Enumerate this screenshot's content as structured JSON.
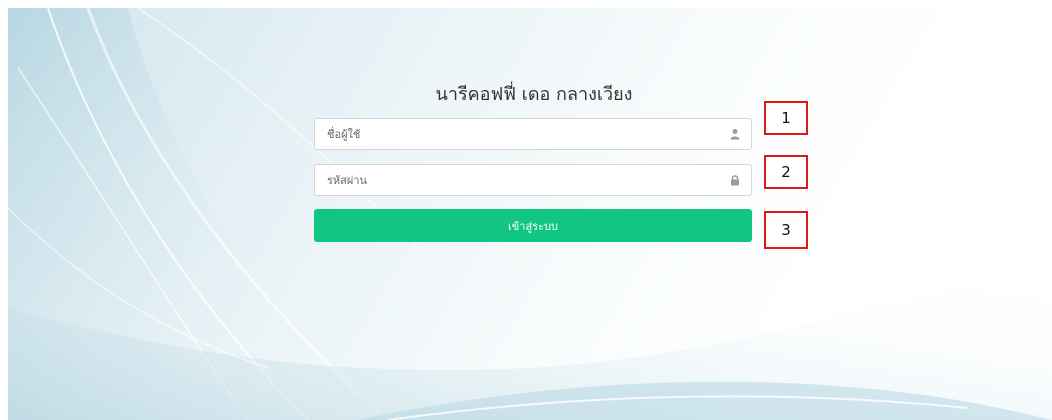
{
  "app": {
    "title": "นารีคอฟฟี่ เดอ กลางเวียง"
  },
  "login": {
    "username_placeholder": "ชื่อผู้ใช้",
    "username_value": "",
    "password_placeholder": "รหัสผ่าน",
    "password_value": "",
    "submit_label": "เข้าสู่ระบบ",
    "submit_color": "#11c583",
    "username_icon": "user-icon",
    "password_icon": "lock-icon"
  },
  "annotations": {
    "marker_1": "1",
    "marker_2": "2",
    "marker_3": "3",
    "marker_color": "#e01818"
  }
}
